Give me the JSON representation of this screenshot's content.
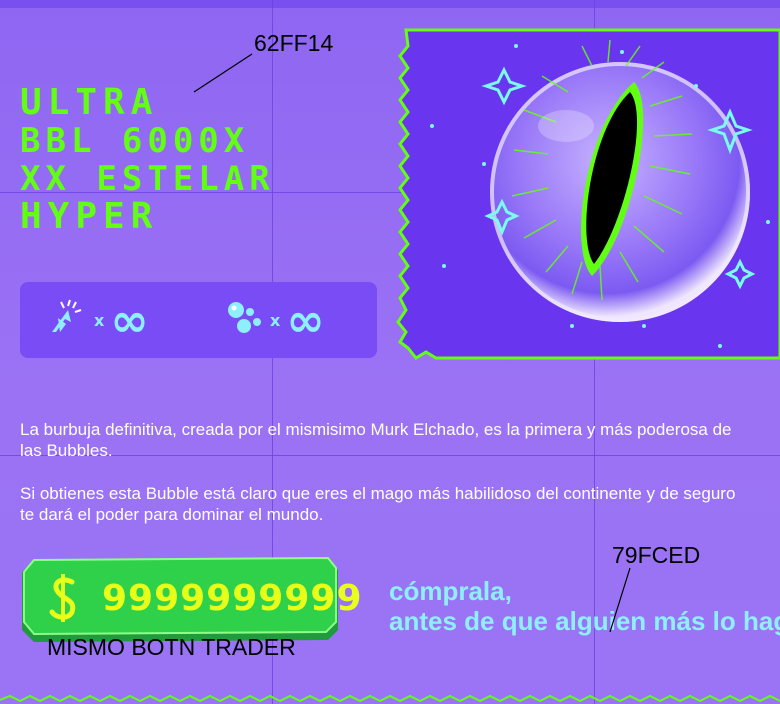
{
  "title": {
    "lines": [
      "ULTRA",
      "BBL 6000X",
      "XX ESTELAR",
      "HYPER"
    ]
  },
  "annotations": {
    "color_tag_1": "62FF14",
    "color_tag_2": "79FCED",
    "button_note": "MISMO BOTN TRADER"
  },
  "stats": {
    "clicks": {
      "icon": "cursor-click-icon",
      "multiplier": "x",
      "value": "∞"
    },
    "bubbles": {
      "icon": "bubbles-icon",
      "multiplier": "x",
      "value": "∞"
    }
  },
  "hero": {
    "image": "bubble-eye-illustration"
  },
  "description": {
    "p1_line1": "La burbuja definitiva, creada por el mismisimo Murk Elchado, es la primera y más poderosa de",
    "p1_line2": "las Bubbles.",
    "p2_line1": "Si obtienes esta Bubble está claro que eres el mago más habilidoso del continente y de seguro",
    "p2_line2": "te dará el poder para dominar el mundo."
  },
  "buy_button": {
    "icon": "dollar-icon",
    "price": "9999999999"
  },
  "tagline": {
    "line1": "cómprala,",
    "line2": "antes de que alguien más lo haga"
  },
  "colors": {
    "background": "#8f66f3",
    "title": "#62ff14",
    "accent": "#79fced",
    "price": "#e8ff1a",
    "panel": "#7a4cf5",
    "button": "#2fd14a"
  }
}
